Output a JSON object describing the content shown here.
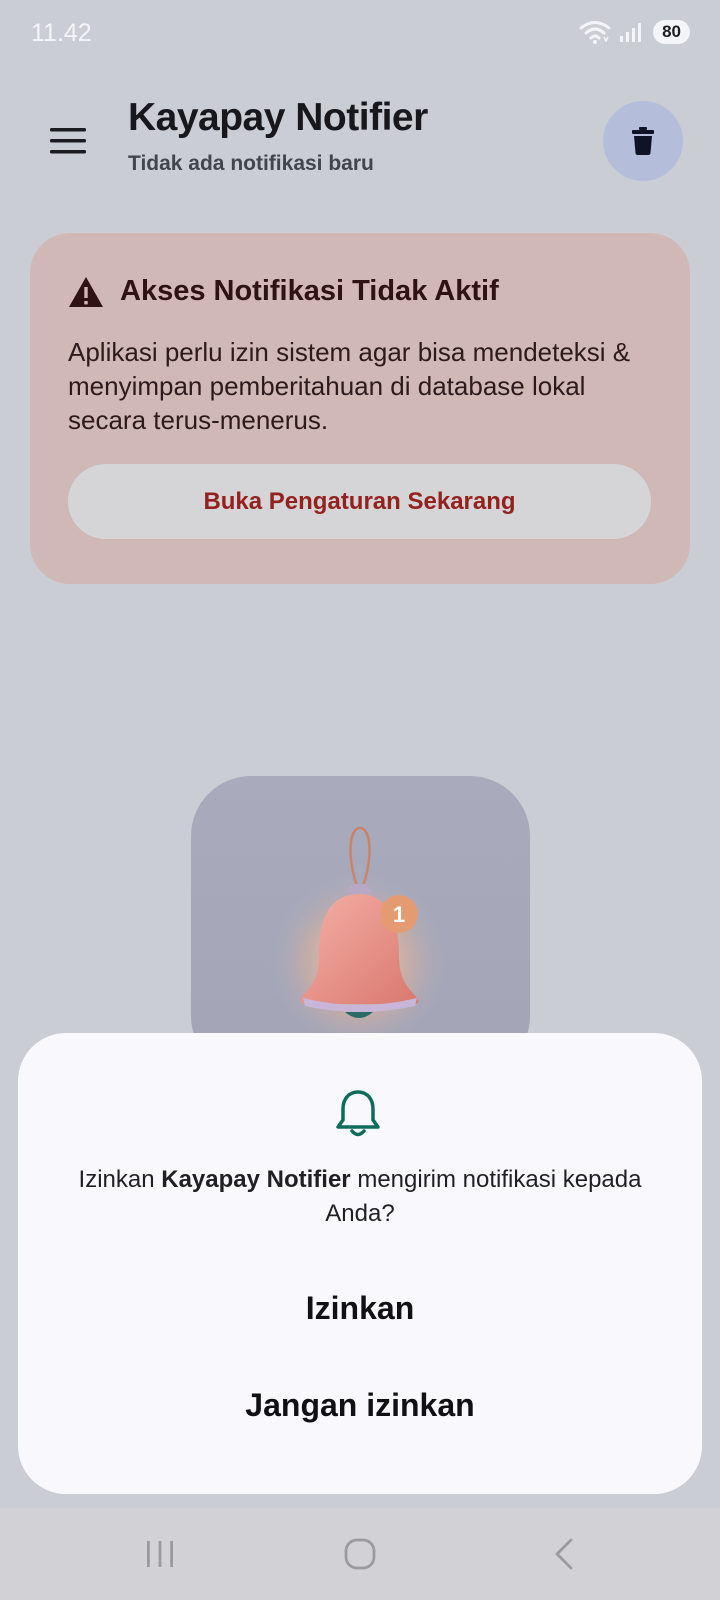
{
  "status_bar": {
    "time": "11.42",
    "battery": "80",
    "icons": [
      "wifi-icon",
      "signal-icon"
    ]
  },
  "app_bar": {
    "title": "Kayapay Notifier",
    "subtitle": "Tidak ada notifikasi baru",
    "menu_icon": "menu-icon",
    "delete_icon": "trash-icon",
    "delete_button_color": "#b4bedb"
  },
  "warning_card": {
    "title": "Akses Notifikasi Tidak Aktif",
    "message": "Aplikasi perlu izin sistem agar bisa mendeteksi & menyimpan pemberitahuan di database lokal secara terus-menerus.",
    "button_label": "Buka Pengaturan Sekarang",
    "background_color": "#d0b8b7",
    "accent_color": "#93221e"
  },
  "illustration": {
    "badge_count": "1"
  },
  "permission_dialog": {
    "message_prefix": "Izinkan ",
    "app_name": "Kayapay Notifier",
    "message_suffix": " mengirim notifikasi kepada Anda?",
    "allow_label": "Izinkan",
    "deny_label": "Jangan izinkan",
    "icon": "bell-outline-icon",
    "icon_color": "#0f6b5c"
  },
  "nav_bar": {
    "items": [
      "recent-apps-icon",
      "home-icon",
      "back-icon"
    ]
  }
}
